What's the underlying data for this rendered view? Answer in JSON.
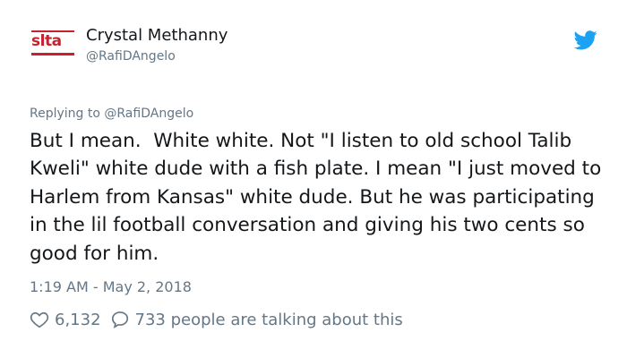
{
  "user": {
    "avatar_text": "slta",
    "display_name": "Crystal Methanny",
    "handle": "@RafiDAngelo"
  },
  "reply": {
    "prefix": "Replying to",
    "to_handle": "@RafiDAngelo"
  },
  "tweet": {
    "text": "But I mean.  White white. Not \"I listen to old school Talib Kweli\" white dude with a fish plate. I mean \"I just moved to Harlem from Kansas\" white dude. But he was participating in the lil football conversation and giving his two cents so good for him.",
    "timestamp": "1:19 AM - May 2, 2018"
  },
  "engagement": {
    "likes": "6,132",
    "talking": "733 people are talking about this"
  },
  "colors": {
    "text_primary": "#14171a",
    "text_secondary": "#657786",
    "twitter_blue": "#1da1f2",
    "logo_red": "#c8202e"
  }
}
